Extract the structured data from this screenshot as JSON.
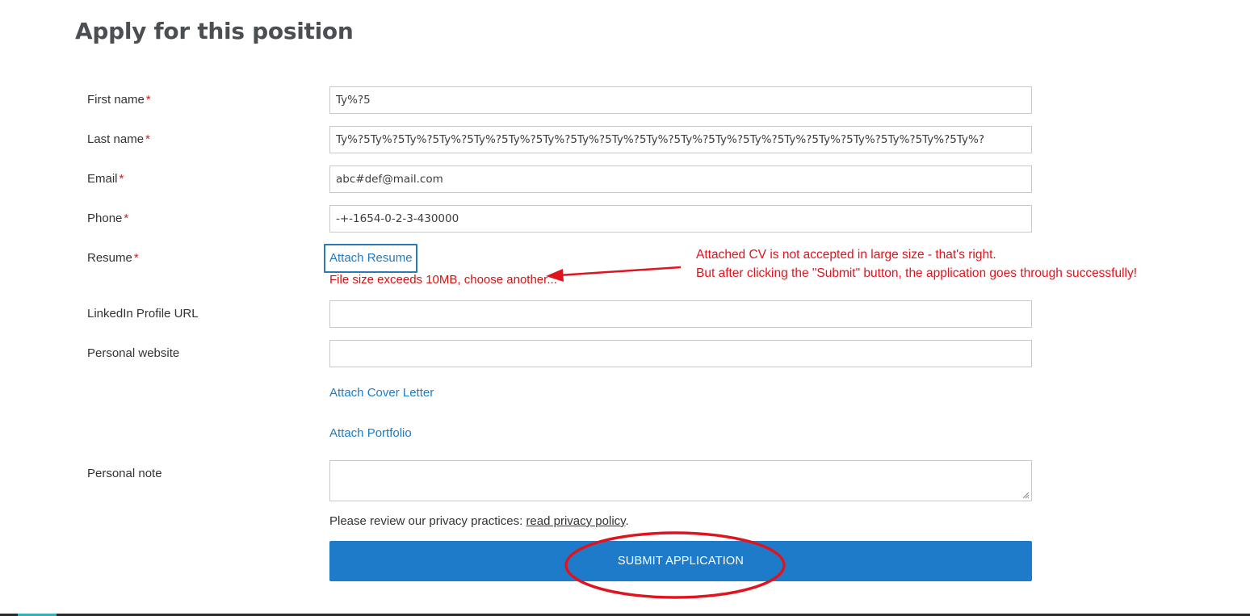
{
  "heading": "Apply for this position",
  "required_marker": "*",
  "fields": {
    "first_name": {
      "label": "First name",
      "value": "Ty%?5"
    },
    "last_name": {
      "label": "Last name",
      "value": "Ty%?5Ty%?5Ty%?5Ty%?5Ty%?5Ty%?5Ty%?5Ty%?5Ty%?5Ty%?5Ty%?5Ty%?5Ty%?5Ty%?5Ty%?5Ty%?5Ty%?5Ty%?5Ty%?"
    },
    "email": {
      "label": "Email",
      "value": "abc#def@mail.com"
    },
    "phone": {
      "label": "Phone",
      "value": "-+-1654-0-2-3-430000"
    },
    "resume": {
      "label": "Resume",
      "button_label": "Attach Resume",
      "error": "File size exceeds 10MB, choose another..."
    },
    "linkedin": {
      "label": "LinkedIn Profile URL",
      "value": ""
    },
    "website": {
      "label": "Personal website",
      "value": ""
    },
    "cover_letter_link": "Attach Cover Letter",
    "portfolio_link": "Attach Portfolio",
    "personal_note": {
      "label": "Personal note",
      "value": ""
    }
  },
  "privacy": {
    "text": "Please review our privacy practices: ",
    "link": "read privacy policy",
    "suffix": "."
  },
  "submit_label": "SUBMIT APPLICATION",
  "annotation": {
    "line1": "Attached CV is not accepted in large size - that's right.",
    "line2": "But after clicking the \"Submit\" button, the application goes through successfully!",
    "color": "#e0141e"
  },
  "colors": {
    "accent": "#1e7bc9",
    "link": "#1f7bc2",
    "error": "#d21313"
  }
}
